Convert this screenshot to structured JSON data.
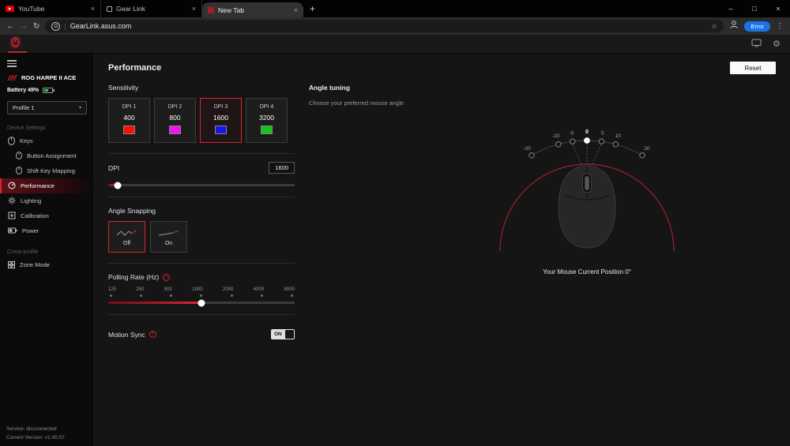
{
  "browser": {
    "tabs": [
      {
        "title": "YouTube"
      },
      {
        "title": "Gear Link"
      },
      {
        "title": "New Tab"
      }
    ],
    "url": "GearLink.asus.com",
    "profile_error_label": "Error"
  },
  "sidebar": {
    "device_name": "ROG HARPE II ACE",
    "battery_label": "Battery 49%",
    "profile_value": "Profile 1",
    "section_device": "Device Settings",
    "items": [
      {
        "label": "Keys"
      },
      {
        "label": "Button Assignment"
      },
      {
        "label": "Shift Key Mapping"
      },
      {
        "label": "Performance"
      },
      {
        "label": "Lighting"
      },
      {
        "label": "Calibration"
      },
      {
        "label": "Power"
      }
    ],
    "section_cross": "Cross-profile",
    "zone_item": "Zone Mode",
    "service_status": "Service: disconnected",
    "version": "Current Version: v1.00.07"
  },
  "performance": {
    "title": "Performance",
    "reset_label": "Reset",
    "sensitivity": {
      "label": "Sensitivity",
      "stages": [
        {
          "name": "DPI 1",
          "value": "400",
          "color": "#ff0b0b"
        },
        {
          "name": "DPI 2",
          "value": "800",
          "color": "#f312f3"
        },
        {
          "name": "DPI 3",
          "value": "1600",
          "color": "#1616e8"
        },
        {
          "name": "DPI 4",
          "value": "3200",
          "color": "#12c41b"
        }
      ]
    },
    "dpi": {
      "label": "DPI",
      "value": "1600"
    },
    "angle_snapping": {
      "label": "Angle Snapping",
      "off": "Off",
      "on": "On"
    },
    "polling_rate": {
      "label": "Polling Rate (Hz)",
      "ticks": [
        "125",
        "250",
        "500",
        "1000",
        "2000",
        "4000",
        "8000"
      ],
      "selected": "1000"
    },
    "motion_sync": {
      "label": "Motion Sync",
      "state": "ON"
    }
  },
  "angle_tuning": {
    "title": "Angle tuning",
    "subtitle": "Choose your preferred mouse angle",
    "scale_labels": [
      "-20",
      "-10",
      "-5",
      "0",
      "5",
      "10",
      "20"
    ],
    "position_label": "Your Mouse Current Position 0°"
  },
  "colors": {
    "accent": "#cf2733",
    "error_badge": "#1a73e8"
  }
}
